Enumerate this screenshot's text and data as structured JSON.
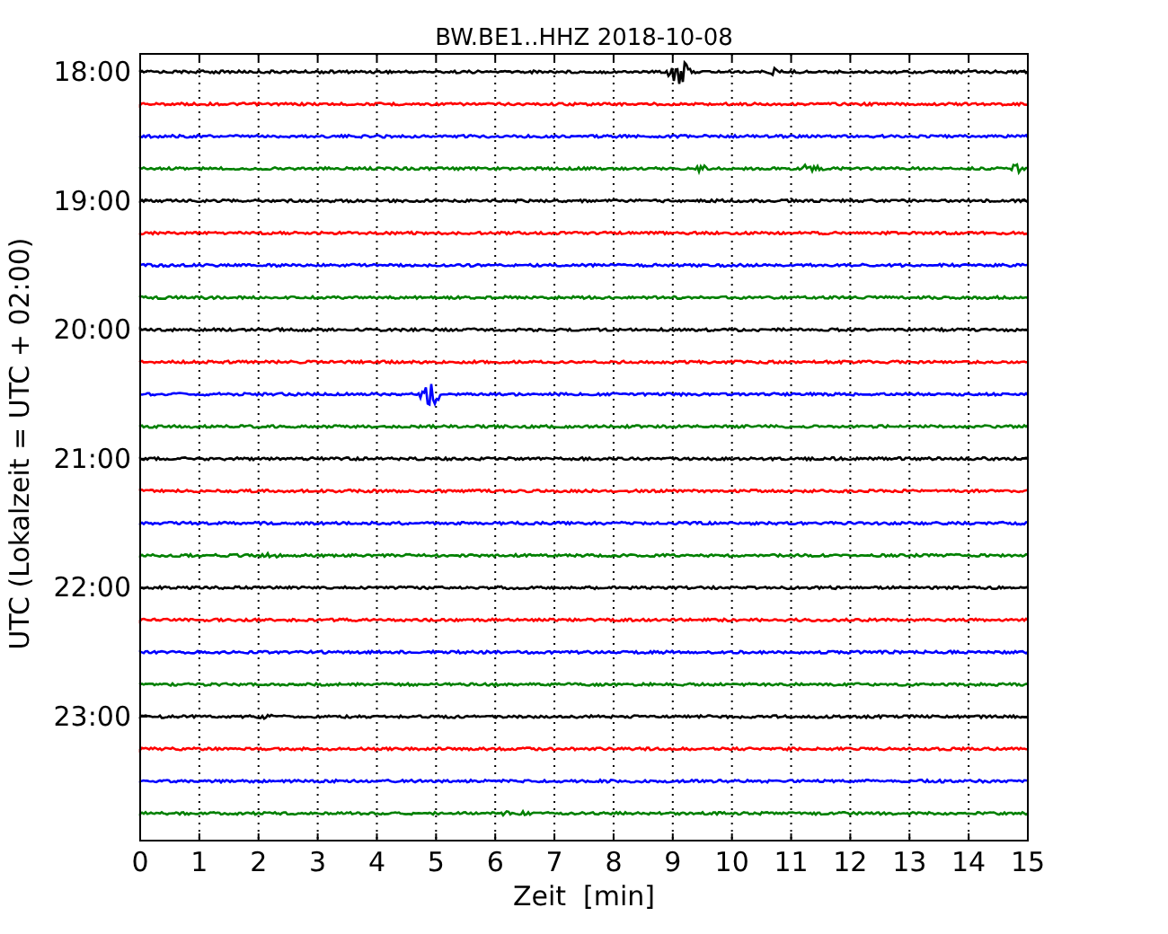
{
  "plot": {
    "title": "BW.BE1..HHZ 2018-10-08",
    "xlabel": "Zeit  [min]",
    "ylabel": "UTC (Lokalzeit = UTC + 02:00)",
    "xticks": [
      "0",
      "1",
      "2",
      "3",
      "4",
      "5",
      "6",
      "7",
      "8",
      "9",
      "10",
      "11",
      "12",
      "13",
      "14",
      "15"
    ],
    "yticks": [
      "18:00",
      "19:00",
      "20:00",
      "21:00",
      "22:00",
      "23:00"
    ],
    "traces": [
      {
        "color": "#000000"
      },
      {
        "color": "#ff0000"
      },
      {
        "color": "#0000ff"
      },
      {
        "color": "#008000"
      },
      {
        "color": "#000000"
      },
      {
        "color": "#ff0000"
      },
      {
        "color": "#0000ff"
      },
      {
        "color": "#008000"
      },
      {
        "color": "#000000"
      },
      {
        "color": "#ff0000"
      },
      {
        "color": "#0000ff"
      },
      {
        "color": "#008000"
      },
      {
        "color": "#000000"
      },
      {
        "color": "#ff0000"
      },
      {
        "color": "#0000ff"
      },
      {
        "color": "#008000"
      },
      {
        "color": "#000000"
      },
      {
        "color": "#ff0000"
      },
      {
        "color": "#0000ff"
      },
      {
        "color": "#008000"
      },
      {
        "color": "#000000"
      },
      {
        "color": "#ff0000"
      },
      {
        "color": "#0000ff"
      },
      {
        "color": "#008000"
      }
    ]
  }
}
